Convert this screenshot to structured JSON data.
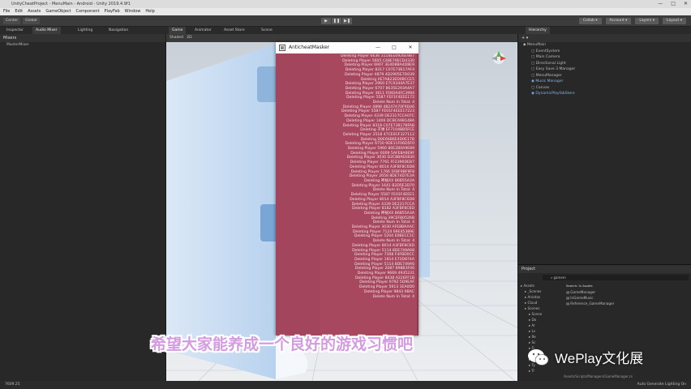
{
  "window": {
    "title": "UnityCheatProject - MenuMain - Android - Unity 2019.4.9f1",
    "minimize": "—",
    "maximize": "□",
    "close": "✕"
  },
  "menu": [
    "File",
    "Edit",
    "Assets",
    "GameObject",
    "Component",
    "PlayFab",
    "Window",
    "Help"
  ],
  "toolbar": {
    "left": [
      "Center",
      "Global"
    ],
    "play_buttons": [
      "▶",
      "❚❚",
      "▶❚"
    ],
    "right": [
      "Collab ▾",
      "Account ▾",
      "Layers ▾",
      "Layout ▾"
    ]
  },
  "tabs": {
    "left": [
      "Inspector",
      "Audio Mixer",
      "Lighting",
      "Navigation"
    ],
    "center": [
      "Game",
      "Animator",
      "Asset Store",
      "Scene"
    ],
    "right": [
      "Hierarchy"
    ]
  },
  "mixers_panel": {
    "title": "Mixers",
    "item": "MasterMixer"
  },
  "game_toolbar": {
    "display": "Shaded",
    "label": "2D"
  },
  "hierarchy": {
    "root": "MenuMain",
    "items": [
      {
        "label": "EventSystem",
        "prefab": false
      },
      {
        "label": "Main Camera",
        "prefab": false
      },
      {
        "label": "Directional Light",
        "prefab": false
      },
      {
        "label": "Easy Save 3 Manager",
        "prefab": false
      },
      {
        "label": "MenuManager",
        "prefab": false
      },
      {
        "label": "Music Manager",
        "prefab": true
      },
      {
        "label": "Canvas",
        "prefab": false
      },
      {
        "label": "DynamicPlayfabStore",
        "prefab": true
      }
    ]
  },
  "project": {
    "title": "Project",
    "search_value": "gamem",
    "search_label": "Search:",
    "filter": "In Assets",
    "tree": [
      "Assets",
      "_Scenes",
      "Aniotas",
      "Cloud",
      "Scenes",
      "Scene",
      "Do",
      "Ar",
      "Ls",
      "Re",
      "Sc",
      "Fi",
      "Pt",
      "Re",
      "Ty",
      "Tr"
    ],
    "files": [
      "GameManager",
      "InGameMusic",
      "Reference_GameManager"
    ],
    "path": "Assets/Scripts/Managers/GameManager.cs"
  },
  "anticheat": {
    "title": "AnticheatMasker",
    "log": [
      "Deleting Player 6636 311BEE0926E9B7",
      "Deleting Player 5605 C48E79ECD4330",
      "Deleting Player 6907 3E4D8BA4D8E9",
      "Deleting Player 8317 C07E73B17AF4",
      "Deleting Player 4879 4D2905E7D039",
      "Deleting 0E7A823ED0BCCE5",
      "Deleting Player 2960 E7C0344A7E37",
      "Deleting Player 6707 8635E293A4A7",
      "Deleting Player 3611 FEKOA4FC3994",
      "Deleting Player 5587 FEF1F4EEE172",
      "Delete Num In Total: 4",
      "Deleting Player 4898 48247A70F9D46",
      "Deleting Player 5587 FE01F4EEE17223",
      "Deleting Player 4339 DE2317CCA07C",
      "Deleting Player 1406 DCBCA9B148A",
      "Deleting Player 8318 C07E73B17BFAB",
      "Deleting 子弹 EF7104BB5FCE",
      "Deleting Player 2518 47CE0CF327112",
      "Deleting D0E66B6E4D0E17B",
      "Deleting Player 6750 9DE11F06D5F0",
      "Deleting Player 5960 80E2B0A9E89",
      "Deleting Player 6009 5AFE8A9E9F",
      "Deleting Player 3030 D2C8BAEE830",
      "Deleting Player 7761 FF2390DEB7",
      "Deleting Player 8014 A3FBF8C6D8",
      "Deleting Player 1766 5FBF9BF9F8",
      "Deleting Player 2658 8DE74D7E3A",
      "Deleting 神秘XX B6B55A3A",
      "Deleting Player 1641 B2D5E3D70",
      "Delete Num In Total: 4",
      "Deleting Player 5587 FE01F4EEE1",
      "Deleting Player 8014 A3FBF8C6D8",
      "Deleting Player 4339 DE2317CCA",
      "Deleting Player 8182 A3FBF8C6D",
      "Deleting 神秘XX B6B55A3A",
      "Deleting 39CEFB0526B",
      "Delete Num In Total: 4",
      "Deleting Player 3030 AFE8BAAAC",
      "Deleting Player 7124 69E45389E",
      "Deleting Player 5204 E0BECC1C",
      "Delete Num In Total: 4",
      "Deleting Player 8014 A3FBF8C6D",
      "Deleting Player 5114 8DE749A68",
      "Deleting Player 7368 F4FBD0CC",
      "Deleting Player 1814 E72D874A",
      "Deleting Player 5114 8DE749A6",
      "Deleting Player 2087 898B3F06",
      "Deleting Player 9669 4935231",
      "Deleting Player 8438 A226FF1B",
      "Deleting Player 9792 5D9EAF",
      "Deleting Player 5913 3EA0D0",
      "Deleting Player 9843 9BAC",
      "Delete Num In Total: 4"
    ]
  },
  "subtitle": "希望大家能养成一个良好的游戏习惯吧",
  "watermark": {
    "brand": "WePlay文化展",
    "icon": "wechat-icon"
  },
  "statusbar": {
    "left": "7609.25",
    "right": "Auto Generate Lighting On"
  }
}
